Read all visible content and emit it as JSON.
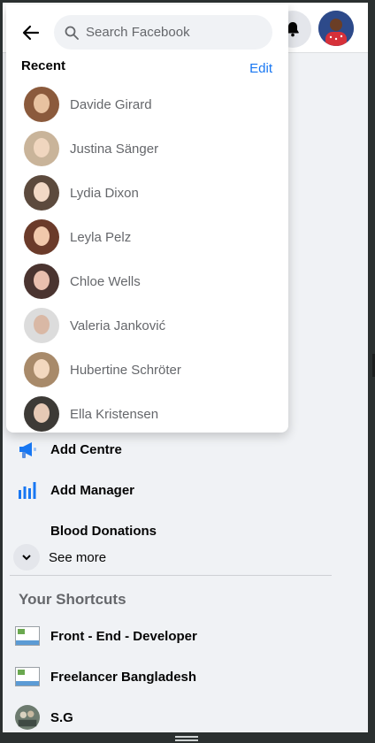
{
  "header": {
    "notifications_icon": "bell-icon",
    "profile_icon": "profile-avatar"
  },
  "search": {
    "placeholder": "Search Facebook",
    "back_icon": "arrow-left-icon",
    "search_icon": "search-icon"
  },
  "recent": {
    "title": "Recent",
    "edit_label": "Edit",
    "items": [
      {
        "name": "Davide Girard",
        "bg": "#8b5a3c"
      },
      {
        "name": "Justina Sänger",
        "bg": "#c9b49a"
      },
      {
        "name": "Lydia Dixon",
        "bg": "#5c4a3d"
      },
      {
        "name": "Leyla Pelz",
        "bg": "#6b3b2a"
      },
      {
        "name": "Chloe Wells",
        "bg": "#4a3430"
      },
      {
        "name": "Valeria Janković",
        "bg": "#2a2a2a"
      },
      {
        "name": "Hubertine Schröter",
        "bg": "#a88a6a"
      },
      {
        "name": "Ella Kristensen",
        "bg": "#3d3a36"
      }
    ]
  },
  "nav": {
    "items": [
      {
        "label": "Add Centre",
        "icon": "megaphone-icon"
      },
      {
        "label": "Add Manager",
        "icon": "bar-chart-icon"
      },
      {
        "label": "Blood Donations",
        "icon": ""
      }
    ],
    "see_more_label": "See more",
    "shortcuts_title": "Your Shortcuts",
    "shortcuts": [
      {
        "label": "Front - End - Developer",
        "icon": "broken-image-icon"
      },
      {
        "label": "Freelancer Bangladesh",
        "icon": "broken-image-icon"
      },
      {
        "label": "S.G",
        "icon": "group-avatar"
      }
    ]
  },
  "colors": {
    "accent": "#1877f2",
    "background": "#f0f2f5",
    "text_secondary": "#65676b"
  }
}
